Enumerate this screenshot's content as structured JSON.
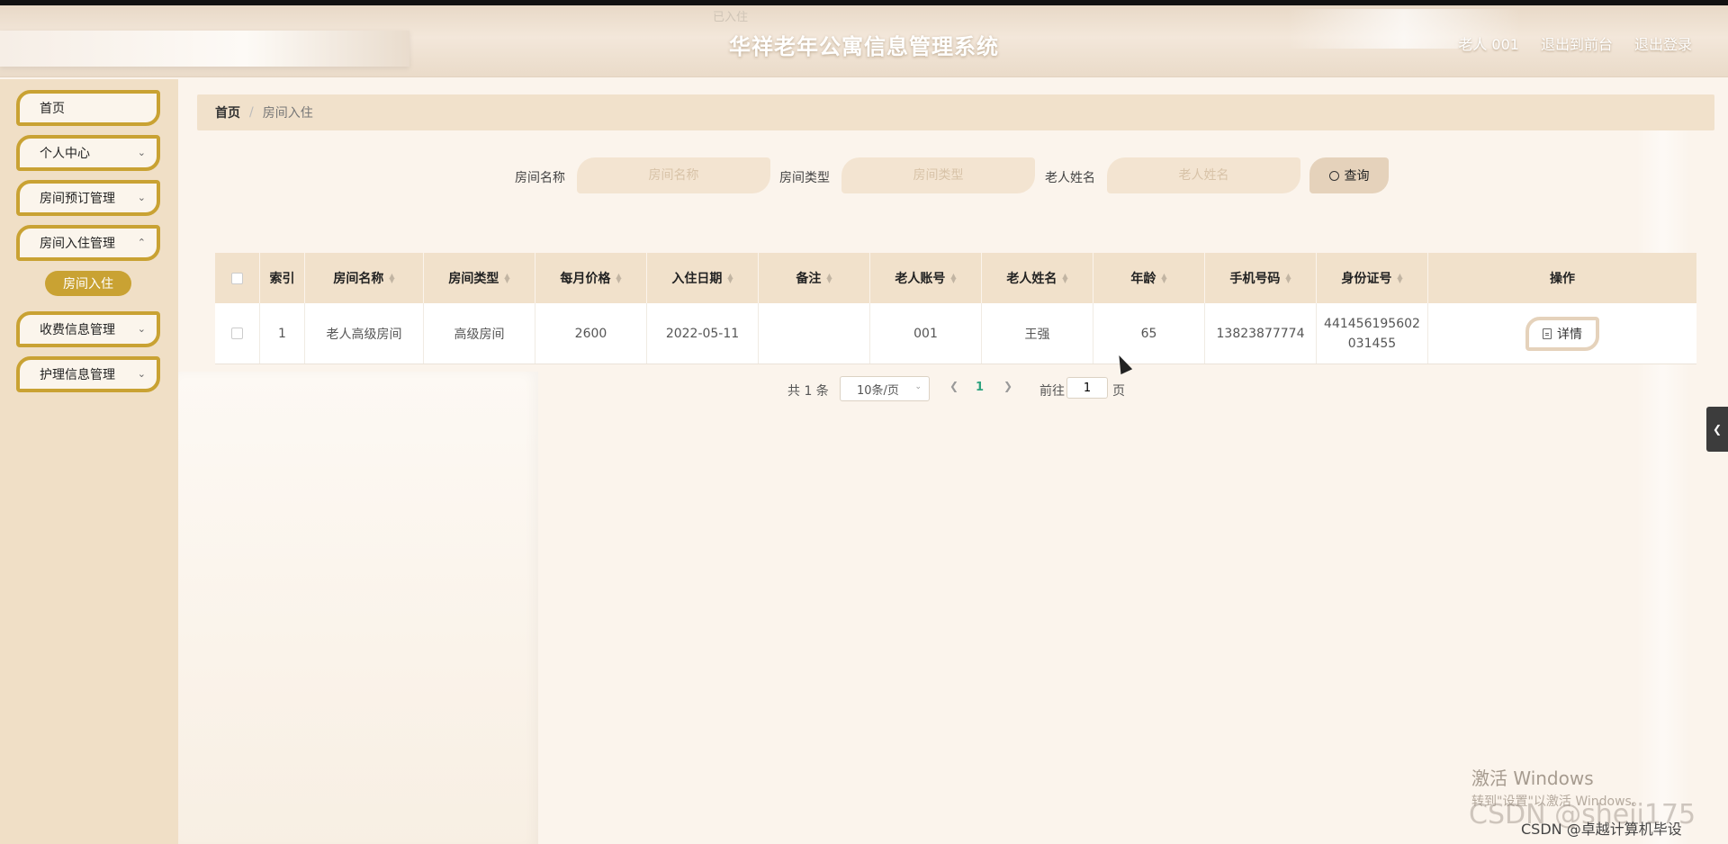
{
  "header": {
    "ghost_text": "已入住",
    "title": "华祥老年公寓信息管理系统",
    "user": "老人 001",
    "to_front": "退出到前台",
    "logout": "退出登录"
  },
  "sidebar": {
    "items": [
      {
        "label": "首页"
      },
      {
        "label": "个人中心"
      },
      {
        "label": "房间预订管理"
      },
      {
        "label": "房间入住管理"
      },
      {
        "label": "房间入住"
      },
      {
        "label": "收费信息管理"
      },
      {
        "label": "护理信息管理"
      }
    ]
  },
  "breadcrumb": {
    "home": "首页",
    "sep": "/",
    "current": "房间入住"
  },
  "search": {
    "room_name_label": "房间名称",
    "room_name_placeholder": "房间名称",
    "room_type_label": "房间类型",
    "room_type_placeholder": "房间类型",
    "elder_name_label": "老人姓名",
    "elder_name_placeholder": "老人姓名",
    "query_label": "查询"
  },
  "table": {
    "headers": [
      "索引",
      "房间名称",
      "房间类型",
      "每月价格",
      "入住日期",
      "备注",
      "老人账号",
      "老人姓名",
      "年龄",
      "手机号码",
      "身份证号",
      "操作"
    ],
    "rows": [
      {
        "index": "1",
        "room_name": "老人高级房间",
        "room_type": "高级房间",
        "price": "2600",
        "date": "2022-05-11",
        "note": "",
        "account": "001",
        "name": "王强",
        "age": "65",
        "phone": "13823877774",
        "id_line1": "441456195602",
        "id_line2": "031455",
        "action": "详情"
      }
    ]
  },
  "pager": {
    "total": "共 1 条",
    "size": "10条/页",
    "page": "1",
    "goto": "前往",
    "goto_value": "1",
    "page_unit": "页"
  },
  "watermark": {
    "line1": "激活 Windows",
    "line2": "转到\"设置\"以激活 Windows。",
    "csdn": "CSDN @sheji175",
    "csdn2": "CSDN @卓越计算机毕设"
  }
}
